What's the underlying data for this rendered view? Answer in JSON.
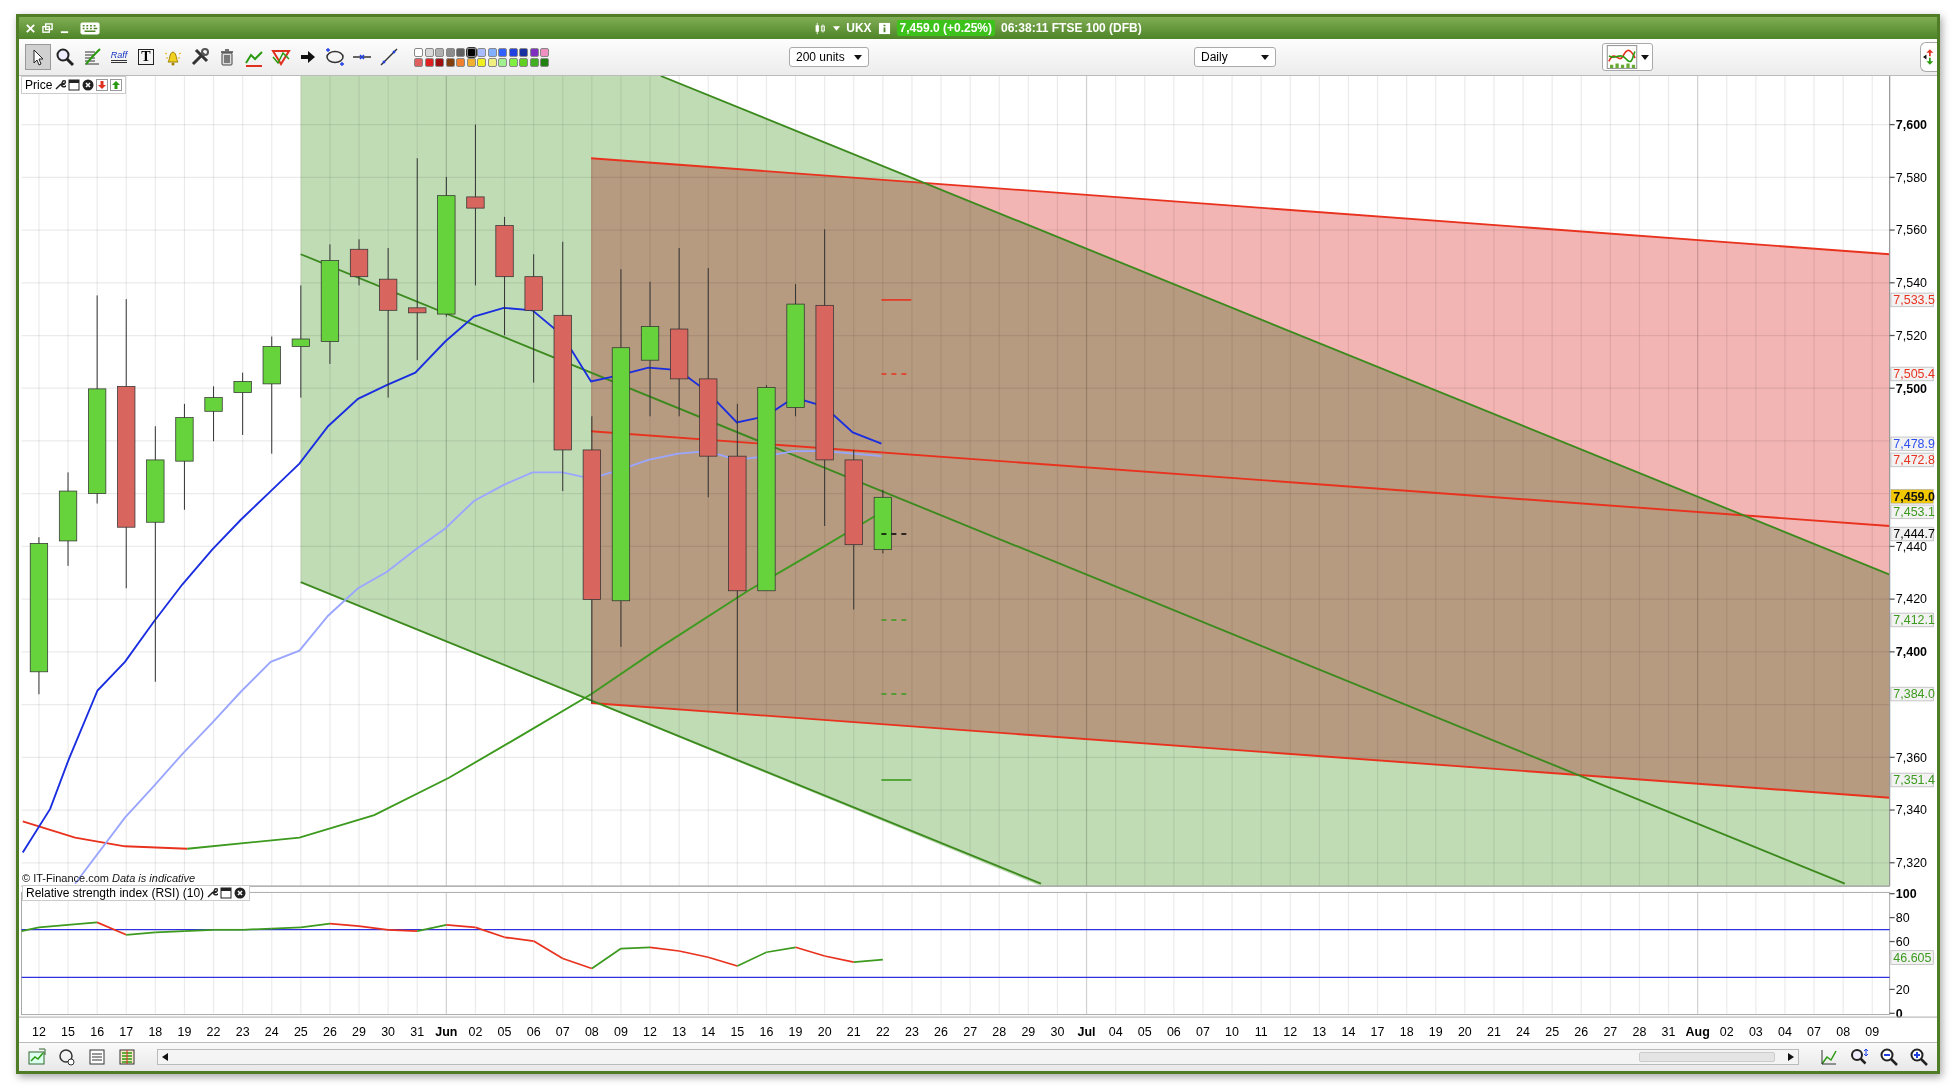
{
  "window": {
    "symbol": "UKX",
    "price_badge": "7,459.0 (+0.25%)",
    "info": "06:38:11 FTSE 100 (DFB)"
  },
  "toolbar": {
    "tools": [
      {
        "kind": "pointer",
        "selected": true
      },
      {
        "kind": "zoom",
        "selected": false
      },
      {
        "kind": "fib",
        "selected": false
      },
      {
        "kind": "raff",
        "label": "Raff",
        "selected": false
      },
      {
        "kind": "text",
        "label": "T",
        "selected": false
      },
      {
        "kind": "alert",
        "selected": false
      },
      {
        "kind": "tools",
        "selected": false
      },
      {
        "kind": "trash",
        "selected": false
      },
      {
        "kind": "zigzag",
        "selected": false
      },
      {
        "kind": "triangle",
        "selected": false
      },
      {
        "kind": "arrow",
        "selected": false
      },
      {
        "kind": "ellipse",
        "selected": false
      },
      {
        "kind": "hline",
        "selected": false
      },
      {
        "kind": "trendline",
        "selected": false
      }
    ],
    "palette": [
      {
        "color": "#ffffff",
        "selected": false
      },
      {
        "color": "#d8d8d8",
        "selected": false
      },
      {
        "color": "#b0b0b0",
        "selected": false
      },
      {
        "color": "#8c8c8c",
        "selected": false
      },
      {
        "color": "#606060",
        "selected": false
      },
      {
        "color": "#000000",
        "selected": true
      },
      {
        "color": "#a8bcff",
        "selected": false
      },
      {
        "color": "#80b0ff",
        "selected": false
      },
      {
        "color": "#3060ff",
        "selected": false
      },
      {
        "color": "#2040e0",
        "selected": false
      },
      {
        "color": "#1830a0",
        "selected": false
      },
      {
        "color": "#8030c0",
        "selected": false
      },
      {
        "color": "#f090c0",
        "selected": false
      },
      {
        "color": "#e06060",
        "selected": false
      },
      {
        "color": "#e02020",
        "selected": false
      },
      {
        "color": "#a01010",
        "selected": false
      },
      {
        "color": "#804010",
        "selected": false
      },
      {
        "color": "#f08030",
        "selected": false
      },
      {
        "color": "#f0b030",
        "selected": false
      },
      {
        "color": "#f0f020",
        "selected": false
      },
      {
        "color": "#f0f080",
        "selected": false
      },
      {
        "color": "#a0f090",
        "selected": false
      },
      {
        "color": "#80f040",
        "selected": false
      },
      {
        "color": "#60d020",
        "selected": false
      },
      {
        "color": "#40b020",
        "selected": false
      },
      {
        "color": "#208010",
        "selected": false
      }
    ],
    "size_select": "200 units",
    "period_select": "Daily"
  },
  "chart": {
    "panel_label": "Price",
    "copyright": "© IT-Finance.com",
    "disclaimer": "Data is indicative",
    "price_labels": [
      "7,600",
      "7,580",
      "7,560",
      "7,540",
      "7,520",
      "7,500",
      "7,440",
      "7,420",
      "7,400",
      "7,360",
      "7,340",
      "7,320"
    ],
    "price_markers": [
      {
        "label": "7,533.5",
        "color": "#e8321e",
        "kind": "solid"
      },
      {
        "label": "7,505.4",
        "color": "#e8321e",
        "kind": "dashed"
      },
      {
        "label": "7,478.9",
        "color": "#2f4ef0",
        "kind": "plain"
      },
      {
        "label": "7,472.8",
        "color": "#e8321e",
        "kind": "plain"
      },
      {
        "label": "7,459.0",
        "kind": "current"
      },
      {
        "label": "7,453.1",
        "color": "#3c9a1e",
        "kind": "plain"
      },
      {
        "label": "7,444.7",
        "color": "#000000",
        "kind": "dashed"
      },
      {
        "label": "7,412.1",
        "color": "#3c9a1e",
        "kind": "dashed"
      },
      {
        "label": "7,384.0",
        "color": "#3c9a1e",
        "kind": "dashed"
      },
      {
        "label": "7,351.4",
        "color": "#3c9a1e",
        "kind": "solid"
      }
    ],
    "date_labels": [
      {
        "label": "12",
        "kind": "day"
      },
      {
        "label": "15",
        "kind": "day"
      },
      {
        "label": "16",
        "kind": "day"
      },
      {
        "label": "17",
        "kind": "day"
      },
      {
        "label": "18",
        "kind": "day"
      },
      {
        "label": "19",
        "kind": "day"
      },
      {
        "label": "22",
        "kind": "day"
      },
      {
        "label": "23",
        "kind": "day"
      },
      {
        "label": "24",
        "kind": "day"
      },
      {
        "label": "25",
        "kind": "day"
      },
      {
        "label": "26",
        "kind": "day"
      },
      {
        "label": "29",
        "kind": "day"
      },
      {
        "label": "30",
        "kind": "day"
      },
      {
        "label": "31",
        "kind": "day"
      },
      {
        "label": "Jun",
        "kind": "month"
      },
      {
        "label": "02",
        "kind": "day"
      },
      {
        "label": "05",
        "kind": "day"
      },
      {
        "label": "06",
        "kind": "day"
      },
      {
        "label": "07",
        "kind": "day"
      },
      {
        "label": "08",
        "kind": "day"
      },
      {
        "label": "09",
        "kind": "day"
      },
      {
        "label": "12",
        "kind": "day"
      },
      {
        "label": "13",
        "kind": "day"
      },
      {
        "label": "14",
        "kind": "day"
      },
      {
        "label": "15",
        "kind": "day"
      },
      {
        "label": "16",
        "kind": "day"
      },
      {
        "label": "19",
        "kind": "day"
      },
      {
        "label": "20",
        "kind": "day"
      },
      {
        "label": "21",
        "kind": "day"
      },
      {
        "label": "22",
        "kind": "day"
      },
      {
        "label": "23",
        "kind": "day"
      },
      {
        "label": "26",
        "kind": "day"
      },
      {
        "label": "27",
        "kind": "day"
      },
      {
        "label": "28",
        "kind": "day"
      },
      {
        "label": "29",
        "kind": "day"
      },
      {
        "label": "30",
        "kind": "day"
      },
      {
        "label": "Jul",
        "kind": "month"
      },
      {
        "label": "04",
        "kind": "day"
      },
      {
        "label": "05",
        "kind": "day"
      },
      {
        "label": "06",
        "kind": "day"
      },
      {
        "label": "07",
        "kind": "day"
      },
      {
        "label": "10",
        "kind": "day"
      },
      {
        "label": "11",
        "kind": "day"
      },
      {
        "label": "12",
        "kind": "day"
      },
      {
        "label": "13",
        "kind": "day"
      },
      {
        "label": "14",
        "kind": "day"
      },
      {
        "label": "17",
        "kind": "day"
      },
      {
        "label": "18",
        "kind": "day"
      },
      {
        "label": "19",
        "kind": "day"
      },
      {
        "label": "20",
        "kind": "day"
      },
      {
        "label": "21",
        "kind": "day"
      },
      {
        "label": "24",
        "kind": "day"
      },
      {
        "label": "25",
        "kind": "day"
      },
      {
        "label": "26",
        "kind": "day"
      },
      {
        "label": "27",
        "kind": "day"
      },
      {
        "label": "28",
        "kind": "day"
      },
      {
        "label": "31",
        "kind": "day"
      },
      {
        "label": "Aug",
        "kind": "month"
      },
      {
        "label": "02",
        "kind": "day"
      },
      {
        "label": "03",
        "kind": "day"
      },
      {
        "label": "04",
        "kind": "day"
      },
      {
        "label": "07",
        "kind": "day"
      },
      {
        "label": "08",
        "kind": "day"
      },
      {
        "label": "09",
        "kind": "day"
      }
    ]
  },
  "rsi": {
    "title": "Relative strength index (RSI) (10)",
    "reading": "46.605",
    "axis_labels": [
      "100",
      "80",
      "60",
      "20",
      "0"
    ]
  }
}
